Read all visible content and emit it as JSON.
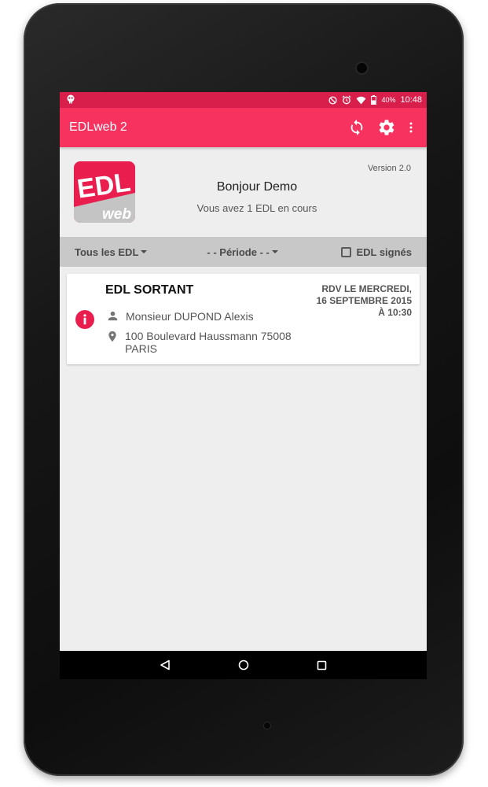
{
  "status_bar": {
    "battery_percent": "40%",
    "time": "10:48"
  },
  "app_bar": {
    "title": "EDLweb 2"
  },
  "header": {
    "logo": {
      "line1": "EDL",
      "line2": "web"
    },
    "version": "Version 2.0",
    "greeting": "Bonjour Demo",
    "summary": "Vous avez 1 EDL en cours"
  },
  "filters": {
    "all_label": "Tous les EDL",
    "period_label": "- - Période - -",
    "signed_label": "EDL signés"
  },
  "edl_list": [
    {
      "title": "EDL SORTANT",
      "rdv_line1": "RDV LE MERCREDI,",
      "rdv_line2": "16 SEPTEMBRE 2015",
      "rdv_line3": "À 10:30",
      "person": "Monsieur DUPOND Alexis",
      "address_line1": "100 Boulevard Haussmann 75008",
      "address_line2": "PARIS"
    }
  ],
  "colors": {
    "status_bar": "#d81e4b",
    "app_bar": "#f7325f",
    "accent": "#e91e4f",
    "background": "#eeeeee",
    "filter_bar": "#c8c8c8"
  },
  "icons": {
    "sync": "sync-icon",
    "settings": "gear-icon",
    "overflow": "more-vert-icon",
    "info": "info-icon",
    "person": "person-icon",
    "location": "location-pin-icon"
  }
}
